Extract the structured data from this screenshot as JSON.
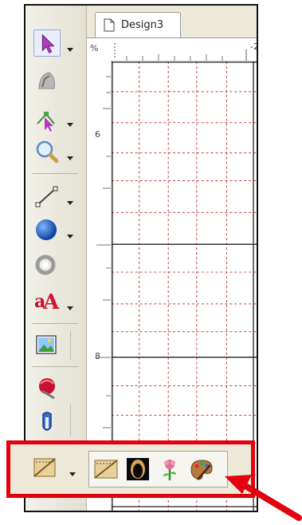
{
  "tab": {
    "title": "Design3"
  },
  "rulers": {
    "corner": "%",
    "h_label": "-2",
    "v_label_1": "6",
    "v_label_2": "8"
  },
  "toolbox": {
    "tools": [
      "pointer-icon",
      "reshape-icon",
      "node-edit-icon",
      "zoom-icon",
      "line-icon",
      "ellipse-icon",
      "rotate-icon",
      "text-icon",
      "image-icon",
      "stitch-icon",
      "pin-icon"
    ]
  },
  "flyout": {
    "icons": [
      "texture-icon",
      "applique-icon",
      "flower-icon",
      "palette-icon"
    ]
  },
  "colors": {
    "highlight": "#e3000f",
    "grid_dash": "#c83c3c",
    "grid_solid": "#222222"
  }
}
